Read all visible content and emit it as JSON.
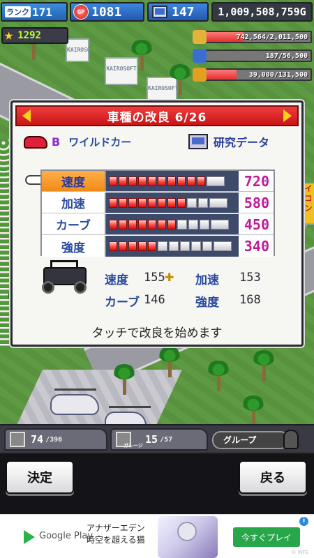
{
  "hud": {
    "rank_label": "ランク",
    "rank_value": "171",
    "gp_coin_label": "GP",
    "gp_value": "1081",
    "research_points": "147",
    "money": "1,009,508,759G",
    "stars": "1292"
  },
  "resources": [
    {
      "text": "742,564/2,011,500",
      "fill_fraction": 0.37,
      "icon": "fuel-barrel-icon",
      "color": "#e4b23a"
    },
    {
      "text": "187/56,500",
      "fill_fraction": 0.003,
      "icon": "oil-bottle-icon",
      "color": "#3a6fd0"
    },
    {
      "text": "39,000/131,500",
      "fill_fraction": 0.3,
      "icon": "wheat-icon",
      "color": "#e0a020"
    }
  ],
  "world": {
    "sign_label": "KAIROSOFT",
    "side_sign": "イコン"
  },
  "dialog": {
    "title": "車種の改良 6/26",
    "car_grade": "B",
    "car_name": "ワイルドカー",
    "research_label": "研究データ",
    "stats": [
      {
        "name": "速度",
        "value": "720",
        "level": 10,
        "max": 11,
        "selected": true
      },
      {
        "name": "加速",
        "value": "580",
        "level": 8,
        "max": 11,
        "selected": false
      },
      {
        "name": "カーブ",
        "value": "450",
        "level": 7,
        "max": 11,
        "selected": false
      },
      {
        "name": "強度",
        "value": "340",
        "level": 5,
        "max": 11,
        "selected": false
      }
    ],
    "current": {
      "speed_label": "速度",
      "speed": "155",
      "accel_label": "加速",
      "accel": "153",
      "curve_label": "カーブ",
      "curve": "146",
      "strength_label": "強度",
      "strength": "168"
    },
    "hint": "タッチで改良を始めます"
  },
  "bottom_info": {
    "parts_count": "74",
    "parts_max": "/396",
    "robots_label": "ガレージ",
    "robots_count": "15",
    "robots_max": "/57",
    "group_label": "グループ"
  },
  "buttons": {
    "decide": "決定",
    "back": "戻る"
  },
  "ad": {
    "store": "Google Play",
    "title_line1": "アナザーエデン",
    "title_line2": "時空を超える猫",
    "cta": "今すぐプレイ",
    "copyright": "© WFS"
  }
}
